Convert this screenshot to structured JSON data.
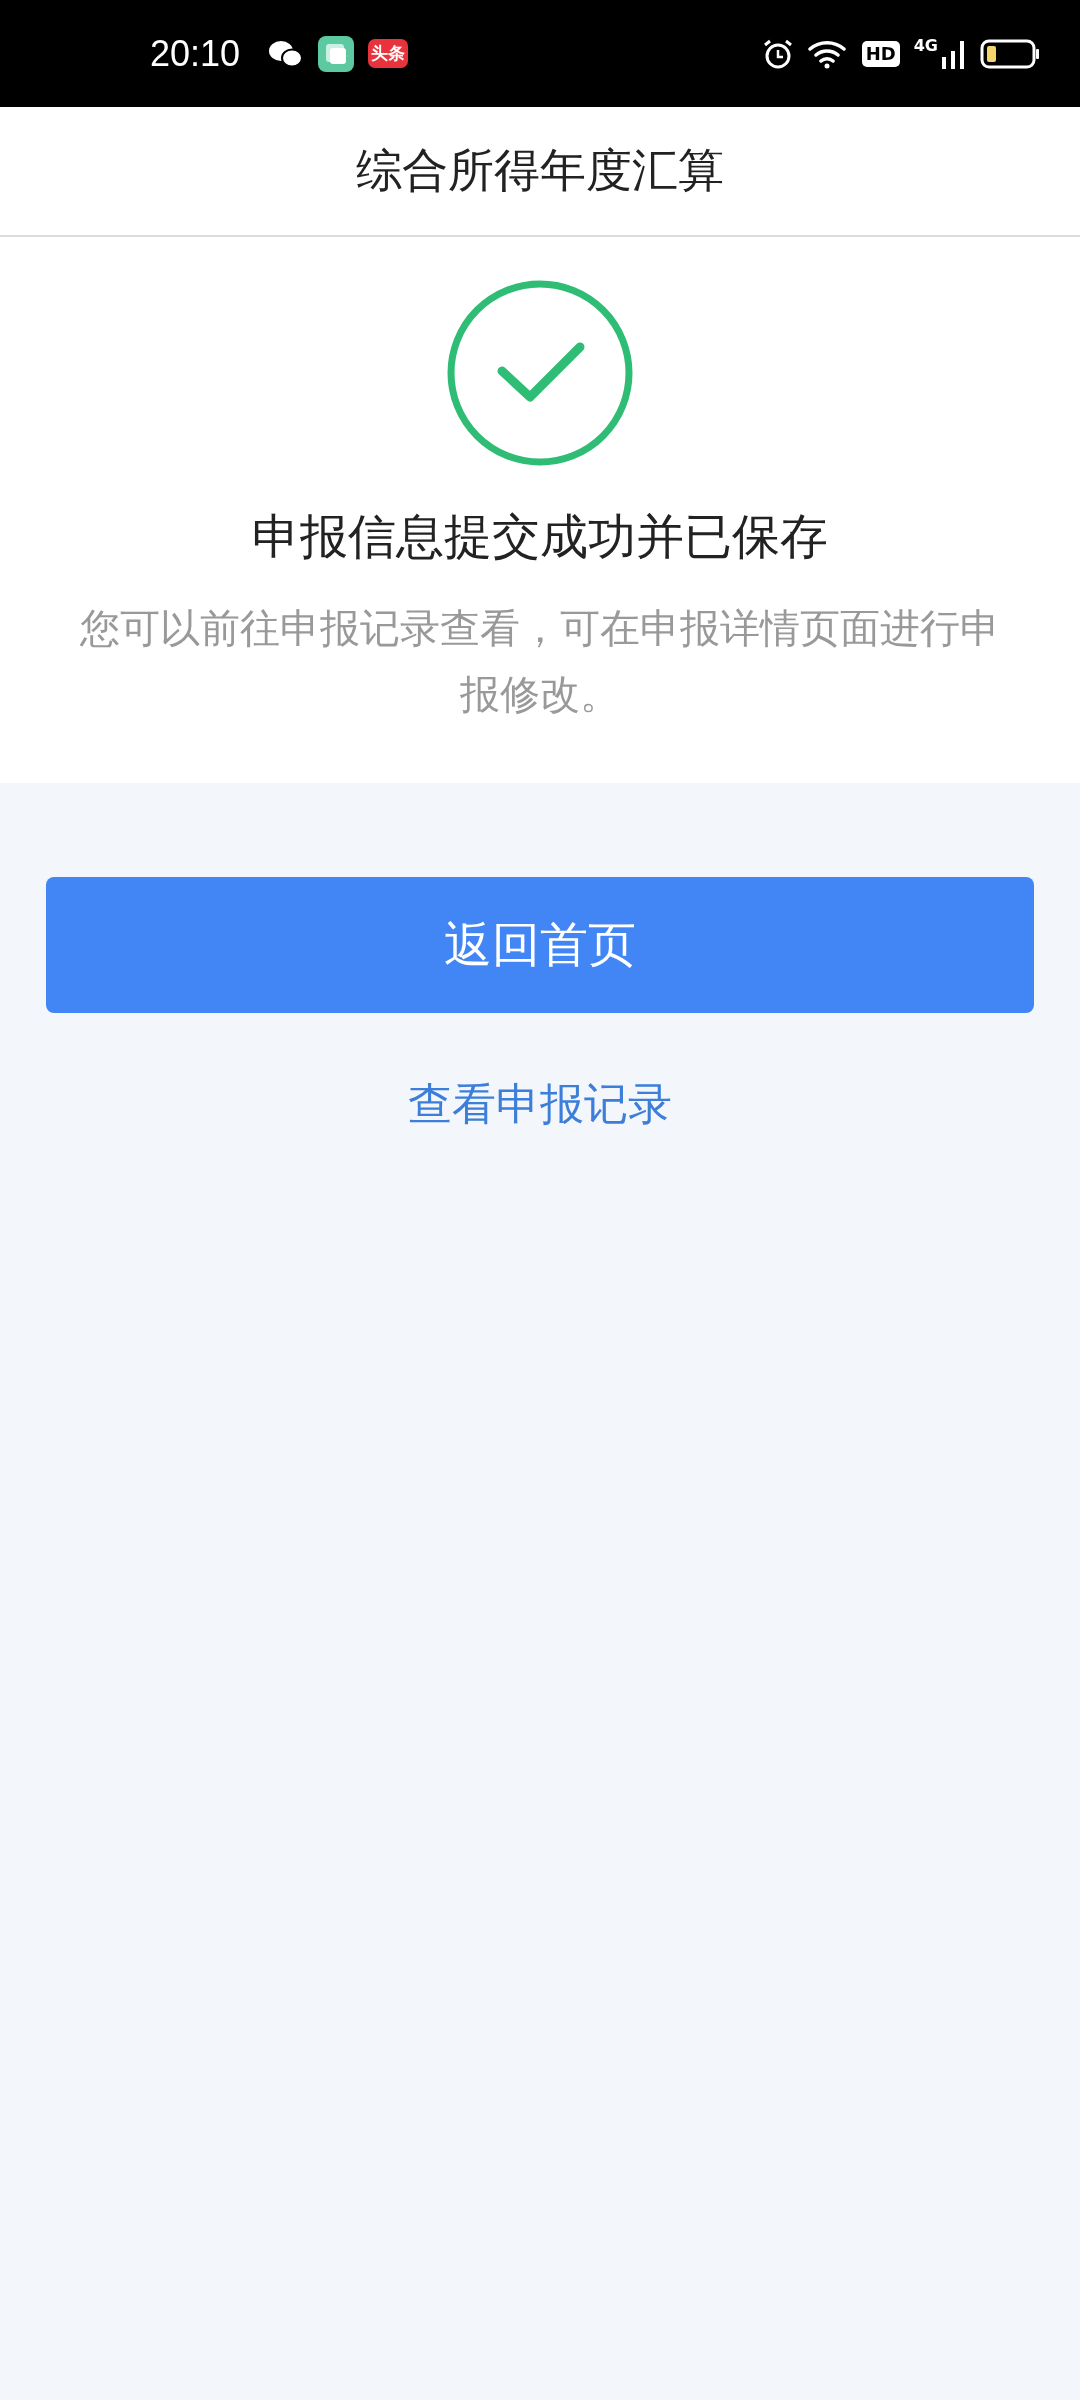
{
  "status_bar": {
    "time": "20:10",
    "app_badge": "头条",
    "hd_badge": "HD",
    "network": "4G"
  },
  "header": {
    "title": "综合所得年度汇算"
  },
  "result": {
    "title": "申报信息提交成功并已保存",
    "message": "您可以前往申报记录查看，可在申报详情页面进行申报修改。"
  },
  "primary_button": "返回首页",
  "link": "查看申报记录"
}
